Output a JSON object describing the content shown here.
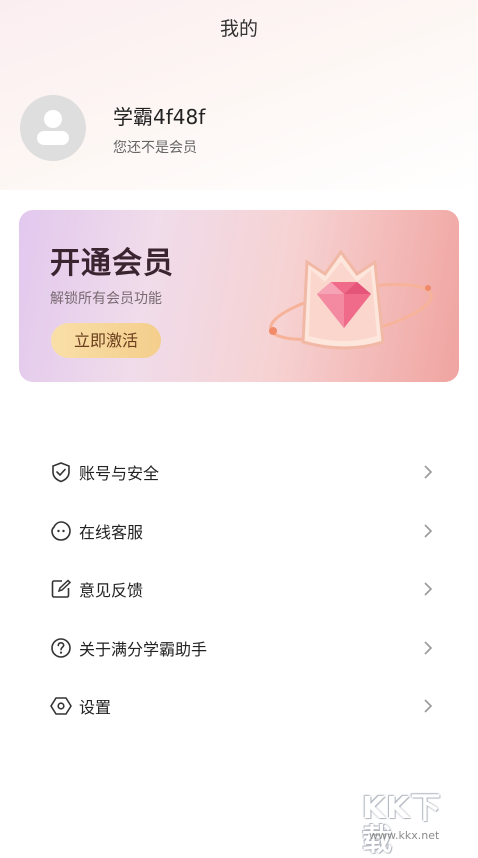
{
  "header": {
    "title": "我的"
  },
  "profile": {
    "username": "学霸4f48f",
    "member_status": "您还不是会员",
    "avatar_icon": "default-avatar-icon"
  },
  "vip_card": {
    "title": "开通会员",
    "subtitle": "解锁所有会员功能",
    "button_label": "立即激活",
    "art_icon": "crown-gem-icon"
  },
  "menu": {
    "items": [
      {
        "label": "账号与安全",
        "icon": "shield-check-icon"
      },
      {
        "label": "在线客服",
        "icon": "customer-service-icon"
      },
      {
        "label": "意见反馈",
        "icon": "edit-feedback-icon"
      },
      {
        "label": "关于满分学霸助手",
        "icon": "question-circle-icon"
      },
      {
        "label": "设置",
        "icon": "settings-hexagon-icon"
      }
    ]
  },
  "watermark": {
    "logo": "KK下载",
    "url": "www.kkx.net"
  },
  "colors": {
    "accent_button": "#f6d699",
    "card_gradient_start": "#e2c8ee",
    "card_gradient_end": "#f0a4a0"
  }
}
